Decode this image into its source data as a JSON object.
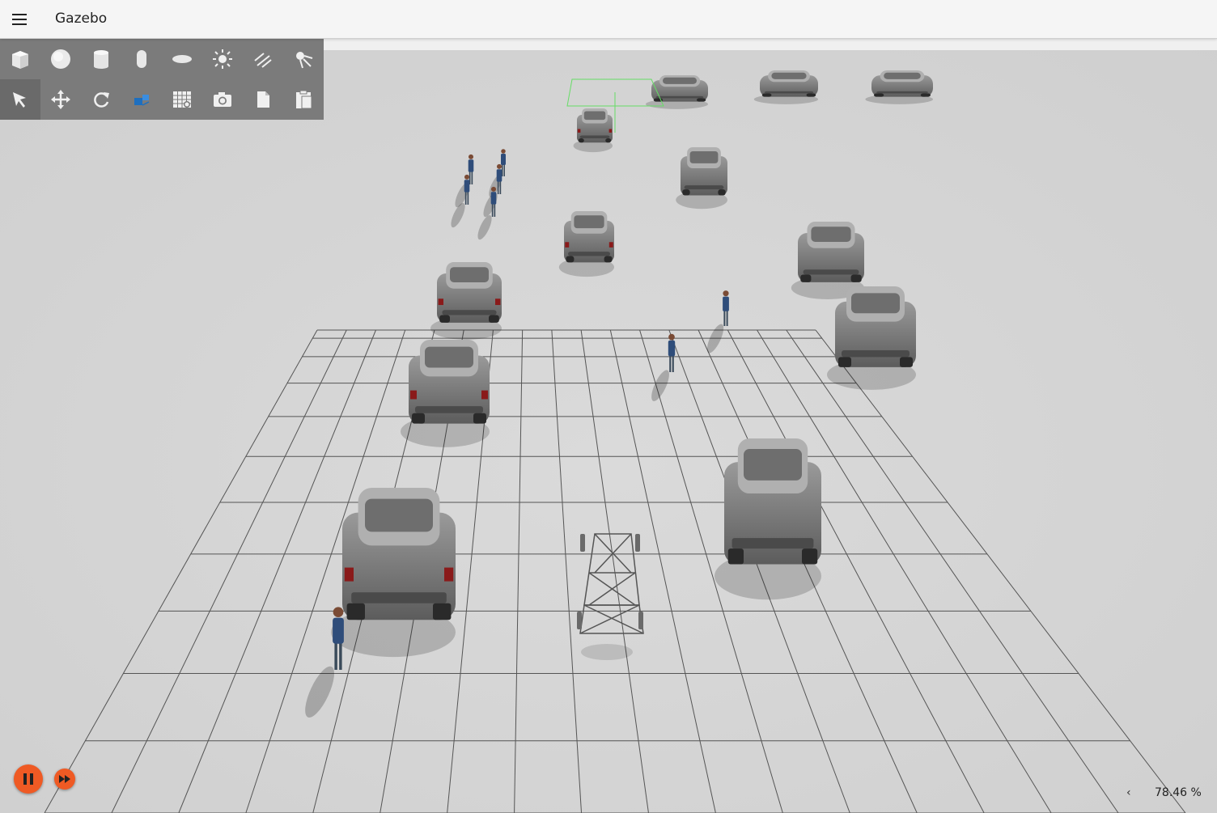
{
  "window": {
    "title": "Gazebo"
  },
  "toolbar": {
    "shapes": [
      {
        "name": "box-icon"
      },
      {
        "name": "sphere-icon"
      },
      {
        "name": "cylinder-icon"
      },
      {
        "name": "capsule-icon"
      },
      {
        "name": "ellipsoid-icon"
      },
      {
        "name": "point-light-icon"
      },
      {
        "name": "directional-light-icon"
      },
      {
        "name": "spot-light-icon"
      }
    ],
    "tools": [
      {
        "name": "select-icon",
        "active": true
      },
      {
        "name": "translate-icon"
      },
      {
        "name": "rotate-icon"
      },
      {
        "name": "transform-control-icon"
      },
      {
        "name": "grid-snap-icon"
      },
      {
        "name": "screenshot-camera-icon"
      },
      {
        "name": "copy-icon"
      },
      {
        "name": "paste-icon"
      }
    ]
  },
  "playback": {
    "state": "playing",
    "pause_icon": "pause-icon",
    "step_icon": "fast-forward-icon"
  },
  "status": {
    "rtf_chevron": "‹",
    "real_time_factor": "78.46 %"
  },
  "colors": {
    "accent": "#ef5a24",
    "toolbar_bg": "#7b7b7b",
    "ground": "#dcdcdc",
    "grid": "#555555",
    "selection": "#66dd66"
  }
}
